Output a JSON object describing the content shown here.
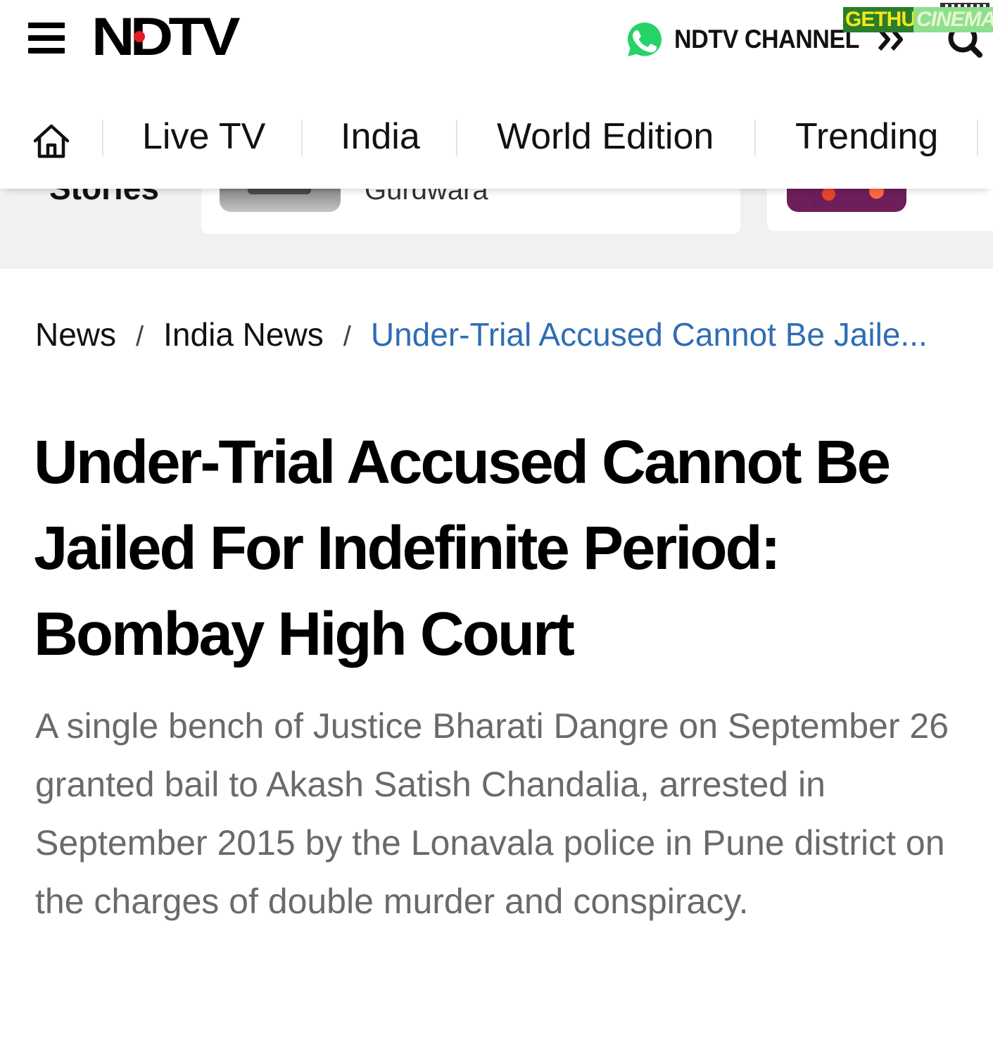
{
  "header": {
    "logo_text": "NDTV",
    "whatsapp_label": "NDTV CHANNEL",
    "watermark_left": "GETHU",
    "watermark_right": "CINEMA"
  },
  "nav": {
    "items": [
      {
        "label": "Live TV"
      },
      {
        "label": "India"
      },
      {
        "label": "World Edition"
      },
      {
        "label": "Trending"
      }
    ]
  },
  "stories": {
    "label": "Stories",
    "cards": [
      {
        "title": "Gurdwara"
      }
    ]
  },
  "breadcrumb": {
    "items": [
      "News",
      "India News"
    ],
    "separator": "/",
    "current": "Under-Trial Accused Cannot Be Jaile..."
  },
  "article": {
    "headline": "Under-Trial Accused Cannot Be Jailed For Indefinite Period: Bombay High Court",
    "summary": "A single bench of Justice Bharati Dangre on September 26 granted bail to Akash Satish Chandalia, arrested in September 2015 by the Lonavala police in Pune district on the charges of double murder and conspiracy."
  },
  "colors": {
    "brand_red": "#e21b22",
    "whatsapp_green": "#25d366",
    "breadcrumb_link": "#2f6db5",
    "summary_text": "#6a6a6a"
  }
}
